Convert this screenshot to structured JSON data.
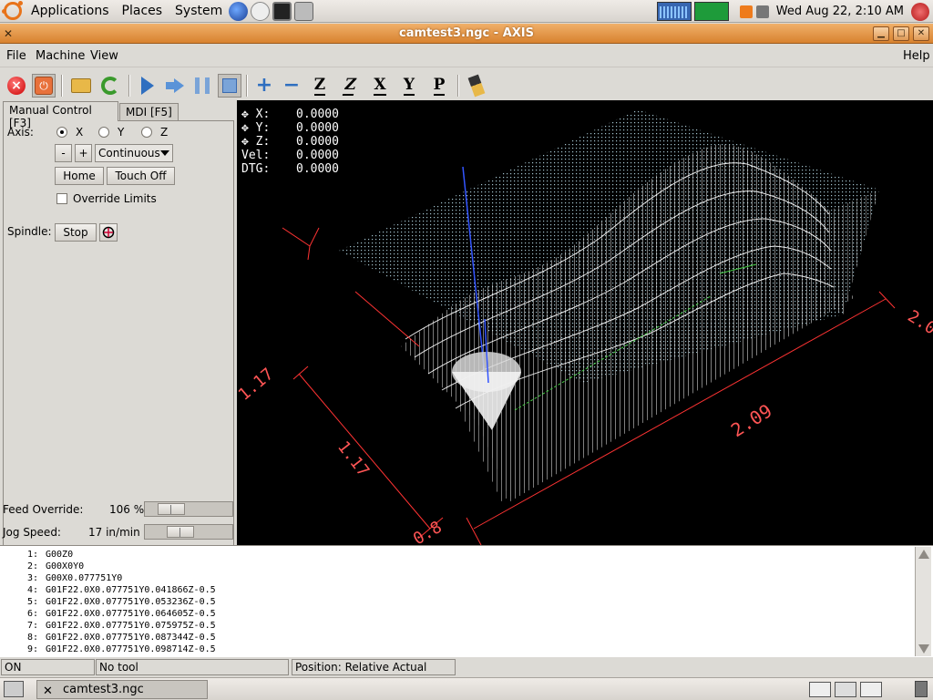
{
  "top_panel": {
    "menus": [
      "Applications",
      "Places",
      "System"
    ],
    "clock": "Wed Aug 22,  2:10 AM"
  },
  "window": {
    "title": "camtest3.ngc - AXIS"
  },
  "menubar": {
    "file": "File",
    "machine": "Machine",
    "view": "View",
    "help": "Help"
  },
  "toolbar": {
    "estop": "×",
    "power": "⏻",
    "zoom_in": "+",
    "zoom_out": "−",
    "view_z": "Z",
    "view_z_rot": "Z",
    "view_x": "X",
    "view_y": "Y",
    "view_p": "P"
  },
  "left_panel": {
    "tabs": [
      "Manual Control [F3]",
      "MDI [F5]"
    ],
    "axis_label": "Axis:",
    "axes": [
      "X",
      "Y",
      "Z"
    ],
    "selected_axis": "X",
    "jog_minus": "-",
    "jog_plus": "+",
    "jog_mode": "Continuous",
    "home": "Home",
    "touch_off": "Touch Off",
    "override_limits": "Override Limits",
    "spindle_label": "Spindle:",
    "spindle_stop": "Stop",
    "feed_override_label": "Feed Override:",
    "feed_override_value": "106 %",
    "jog_speed_label": "Jog Speed:",
    "jog_speed_value": "17 in/min"
  },
  "dro": [
    {
      "label": "X:",
      "value": "0.0000"
    },
    {
      "label": "Y:",
      "value": "0.0000"
    },
    {
      "label": "Z:",
      "value": "0.0000"
    },
    {
      "label": "Vel:",
      "value": "0.0000"
    },
    {
      "label": "DTG:",
      "value": "0.0000"
    }
  ],
  "preview": {
    "dim_left": "1.17",
    "dim_left_2": "1.17",
    "dim_bottom": "2.09",
    "dim_right": "2.0",
    "dim_bottom_partial": "0.8"
  },
  "gcode": [
    {
      "n": "1:",
      "text": "G00Z0"
    },
    {
      "n": "2:",
      "text": "G00X0Y0"
    },
    {
      "n": "3:",
      "text": "G00X0.077751Y0"
    },
    {
      "n": "4:",
      "text": "G01F22.0X0.077751Y0.041866Z-0.5"
    },
    {
      "n": "5:",
      "text": "G01F22.0X0.077751Y0.053236Z-0.5"
    },
    {
      "n": "6:",
      "text": "G01F22.0X0.077751Y0.064605Z-0.5"
    },
    {
      "n": "7:",
      "text": "G01F22.0X0.077751Y0.075975Z-0.5"
    },
    {
      "n": "8:",
      "text": "G01F22.0X0.077751Y0.087344Z-0.5"
    },
    {
      "n": "9:",
      "text": "G01F22.0X0.077751Y0.098714Z-0.5"
    }
  ],
  "status": {
    "machine": "ON",
    "tool": "No tool",
    "position": "Position: Relative Actual"
  },
  "taskbar": {
    "task": "camtest3.ngc"
  },
  "colors": {
    "titlebar": "#d8822f",
    "preview_bg": "#000000",
    "toolpath": "#ffffff",
    "extents": "#ff3333",
    "tool_axis": "#3355ff"
  }
}
